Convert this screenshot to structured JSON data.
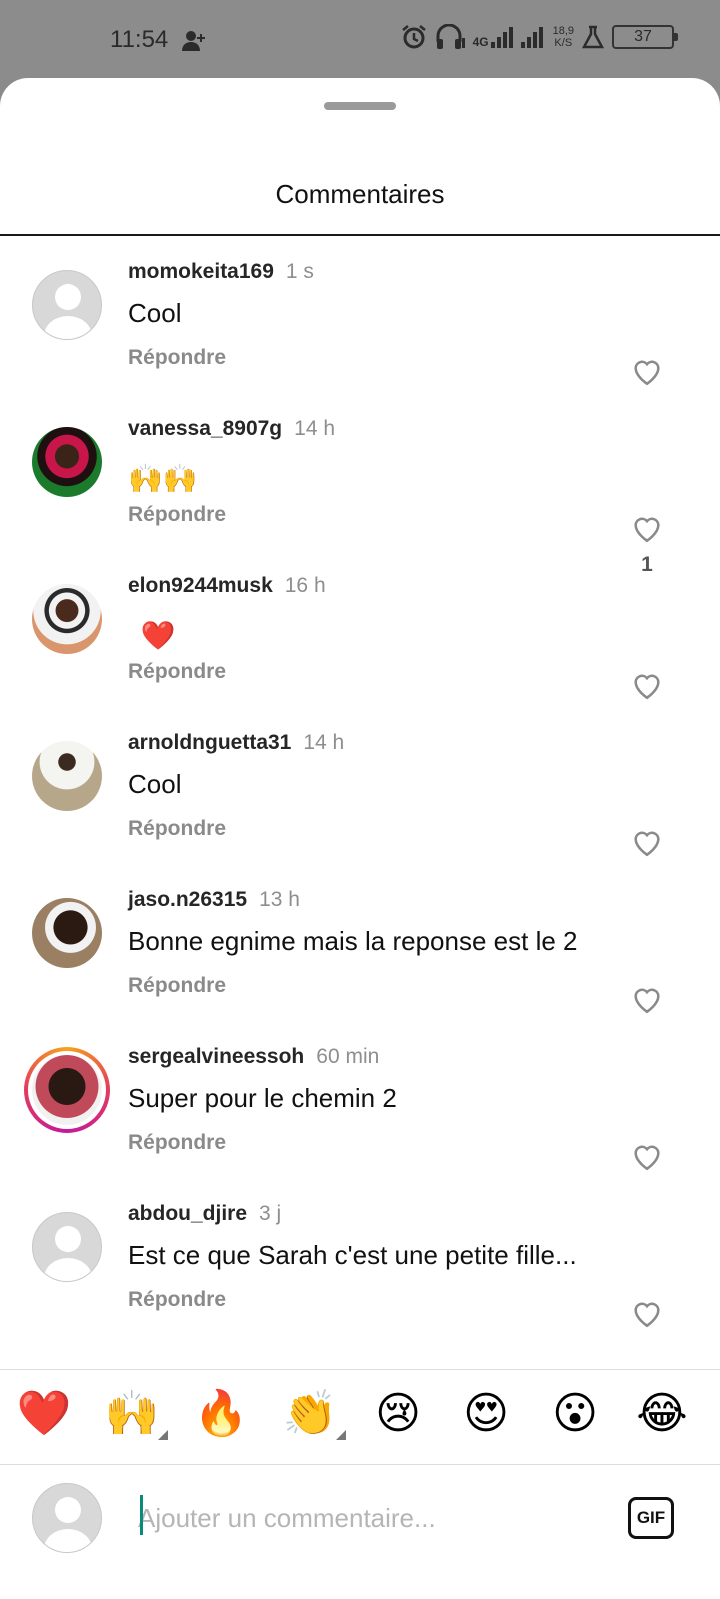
{
  "status_bar": {
    "time": "11:54",
    "network": "4G",
    "speed_value": "18,9",
    "speed_unit": "K/S",
    "battery": "37"
  },
  "sheet": {
    "title": "Commentaires"
  },
  "reply_label": "Répondre",
  "comments": [
    {
      "user": "momokeita169",
      "time": "1 s",
      "text": "Cool",
      "likes": "",
      "avatar": "placeholder"
    },
    {
      "user": "vanessa_8907g",
      "time": "14 h",
      "text": "🙌🙌",
      "likes": "1",
      "avatar": "photo"
    },
    {
      "user": "elon9244musk",
      "time": "16 h",
      "text": "❤️",
      "likes": "",
      "avatar": "photo"
    },
    {
      "user": "arnoldnguetta31",
      "time": "14 h",
      "text": "Cool",
      "likes": "",
      "avatar": "photo"
    },
    {
      "user": "jaso.n26315",
      "time": "13 h",
      "text": "Bonne egnime mais la reponse est le 2",
      "likes": "",
      "avatar": "photo"
    },
    {
      "user": "sergealvineessoh",
      "time": "60 min",
      "text": "Super pour le chemin 2",
      "likes": "",
      "avatar": "photo-story"
    },
    {
      "user": "abdou_djire",
      "time": "3 j",
      "text": "Est ce que Sarah c'est une petite fille...",
      "likes": "",
      "avatar": "placeholder"
    }
  ],
  "emoji_bar": [
    "❤️",
    "🙌",
    "🔥",
    "👏",
    "😢",
    "😍",
    "😮",
    "😂"
  ],
  "composer": {
    "placeholder": "Ajouter un commentaire...",
    "gif_label": "GIF"
  },
  "colors": {
    "status_bar_bg": "#8c8c8c",
    "story_ring": "#e23b5e",
    "muted_text": "#8e8e8e"
  }
}
